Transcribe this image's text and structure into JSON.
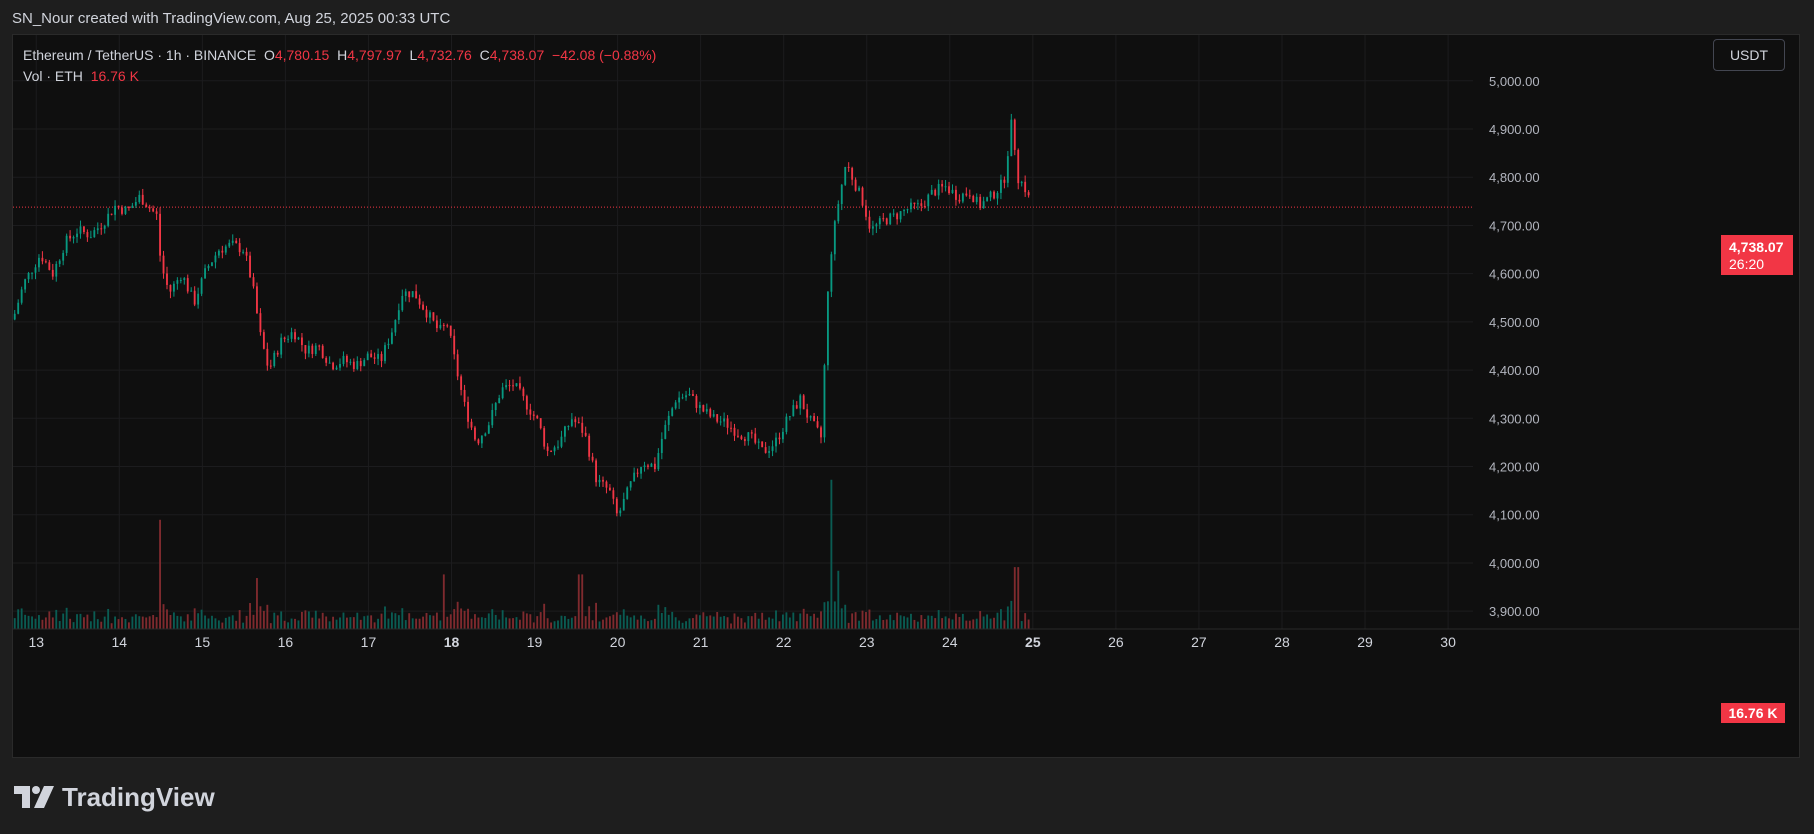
{
  "credit": "SN_Nour created with TradingView.com, Aug 25, 2025 00:33 UTC",
  "brand": "TradingView",
  "legend": {
    "symbol": "Ethereum / TetherUS · 1h · BINANCE",
    "o_label": "O",
    "o_value": "4,780.15",
    "h_label": "H",
    "h_value": "4,797.97",
    "l_label": "L",
    "l_value": "4,732.76",
    "c_label": "C",
    "c_value": "4,738.07",
    "change": "−42.08 (−0.88%)",
    "vol_label": "Vol · ETH",
    "vol_value": "16.76 K"
  },
  "currency": "USDT",
  "price_tag": {
    "price": "4,738.07",
    "countdown": "26:20"
  },
  "vol_tag": "16.76 K",
  "colors": {
    "up": "#089981",
    "down": "#f23645",
    "vol_up": "#0a5c53",
    "vol_down": "#7f2a2e"
  },
  "chart_data": {
    "type": "candlestick",
    "x_ticks": [
      {
        "label": "13",
        "day": 13
      },
      {
        "label": "14",
        "day": 14
      },
      {
        "label": "15",
        "day": 15
      },
      {
        "label": "16",
        "day": 16
      },
      {
        "label": "17",
        "day": 17
      },
      {
        "label": "18",
        "day": 18,
        "bold": true
      },
      {
        "label": "19",
        "day": 19
      },
      {
        "label": "20",
        "day": 20
      },
      {
        "label": "21",
        "day": 21
      },
      {
        "label": "22",
        "day": 22
      },
      {
        "label": "23",
        "day": 23
      },
      {
        "label": "24",
        "day": 24
      },
      {
        "label": "25",
        "day": 25,
        "bold": true
      },
      {
        "label": "26",
        "day": 26
      },
      {
        "label": "27",
        "day": 27
      },
      {
        "label": "28",
        "day": 28
      },
      {
        "label": "29",
        "day": 29
      },
      {
        "label": "30",
        "day": 30
      }
    ],
    "y_ticks": [
      "5,000.00",
      "4,900.00",
      "4,800.00",
      "4,700.00",
      "4,600.00",
      "4,500.00",
      "4,400.00",
      "4,300.00",
      "4,200.00",
      "4,100.00",
      "4,000.00",
      "3,900.00"
    ],
    "y_values": [
      5000,
      4900,
      4800,
      4700,
      4600,
      4500,
      4400,
      4300,
      4200,
      4100,
      4000,
      3900
    ],
    "ylim": [
      3863,
      5095
    ],
    "xlim": [
      12.72,
      30.3
    ],
    "last_price": 4738.07,
    "path": [
      [
        12.72,
        4505
      ],
      [
        12.85,
        4580
      ],
      [
        13.05,
        4640
      ],
      [
        13.2,
        4600
      ],
      [
        13.35,
        4665
      ],
      [
        13.5,
        4690
      ],
      [
        13.65,
        4680
      ],
      [
        13.8,
        4705
      ],
      [
        13.95,
        4740
      ],
      [
        14.1,
        4730
      ],
      [
        14.25,
        4760
      ],
      [
        14.35,
        4740
      ],
      [
        14.45,
        4720
      ],
      [
        14.5,
        4620
      ],
      [
        14.6,
        4560
      ],
      [
        14.75,
        4600
      ],
      [
        14.9,
        4540
      ],
      [
        15.05,
        4610
      ],
      [
        15.2,
        4650
      ],
      [
        15.35,
        4660
      ],
      [
        15.5,
        4650
      ],
      [
        15.6,
        4580
      ],
      [
        15.7,
        4470
      ],
      [
        15.8,
        4400
      ],
      [
        15.95,
        4460
      ],
      [
        16.1,
        4480
      ],
      [
        16.25,
        4440
      ],
      [
        16.4,
        4450
      ],
      [
        16.55,
        4410
      ],
      [
        16.7,
        4420
      ],
      [
        16.85,
        4410
      ],
      [
        17.0,
        4430
      ],
      [
        17.15,
        4420
      ],
      [
        17.3,
        4490
      ],
      [
        17.4,
        4560
      ],
      [
        17.55,
        4560
      ],
      [
        17.7,
        4520
      ],
      [
        17.85,
        4480
      ],
      [
        17.95,
        4495
      ],
      [
        18.05,
        4410
      ],
      [
        18.15,
        4330
      ],
      [
        18.3,
        4250
      ],
      [
        18.45,
        4290
      ],
      [
        18.6,
        4360
      ],
      [
        18.75,
        4370
      ],
      [
        18.9,
        4330
      ],
      [
        19.05,
        4290
      ],
      [
        19.15,
        4230
      ],
      [
        19.3,
        4250
      ],
      [
        19.45,
        4300
      ],
      [
        19.6,
        4270
      ],
      [
        19.75,
        4170
      ],
      [
        19.9,
        4150
      ],
      [
        20.0,
        4095
      ],
      [
        20.15,
        4160
      ],
      [
        20.3,
        4210
      ],
      [
        20.45,
        4200
      ],
      [
        20.55,
        4270
      ],
      [
        20.7,
        4340
      ],
      [
        20.85,
        4350
      ],
      [
        21.0,
        4320
      ],
      [
        21.15,
        4300
      ],
      [
        21.3,
        4290
      ],
      [
        21.45,
        4270
      ],
      [
        21.6,
        4260
      ],
      [
        21.75,
        4230
      ],
      [
        21.9,
        4250
      ],
      [
        22.05,
        4300
      ],
      [
        22.2,
        4340
      ],
      [
        22.3,
        4300
      ],
      [
        22.45,
        4260
      ],
      [
        22.55,
        4620
      ],
      [
        22.65,
        4740
      ],
      [
        22.75,
        4830
      ],
      [
        22.85,
        4790
      ],
      [
        22.95,
        4750
      ],
      [
        23.05,
        4690
      ],
      [
        23.2,
        4710
      ],
      [
        23.35,
        4720
      ],
      [
        23.5,
        4735
      ],
      [
        23.65,
        4740
      ],
      [
        23.8,
        4770
      ],
      [
        23.95,
        4780
      ],
      [
        24.1,
        4760
      ],
      [
        24.25,
        4770
      ],
      [
        24.35,
        4740
      ],
      [
        24.5,
        4760
      ],
      [
        24.65,
        4790
      ],
      [
        24.75,
        4920
      ],
      [
        24.82,
        4800
      ],
      [
        24.9,
        4780
      ],
      [
        24.99,
        4738
      ]
    ],
    "volume_spikes": [
      [
        14.5,
        3.0
      ],
      [
        22.58,
        4.1
      ],
      [
        22.66,
        1.6
      ],
      [
        24.8,
        1.7
      ],
      [
        17.9,
        1.5
      ],
      [
        19.55,
        1.5
      ],
      [
        15.65,
        1.4
      ]
    ]
  }
}
